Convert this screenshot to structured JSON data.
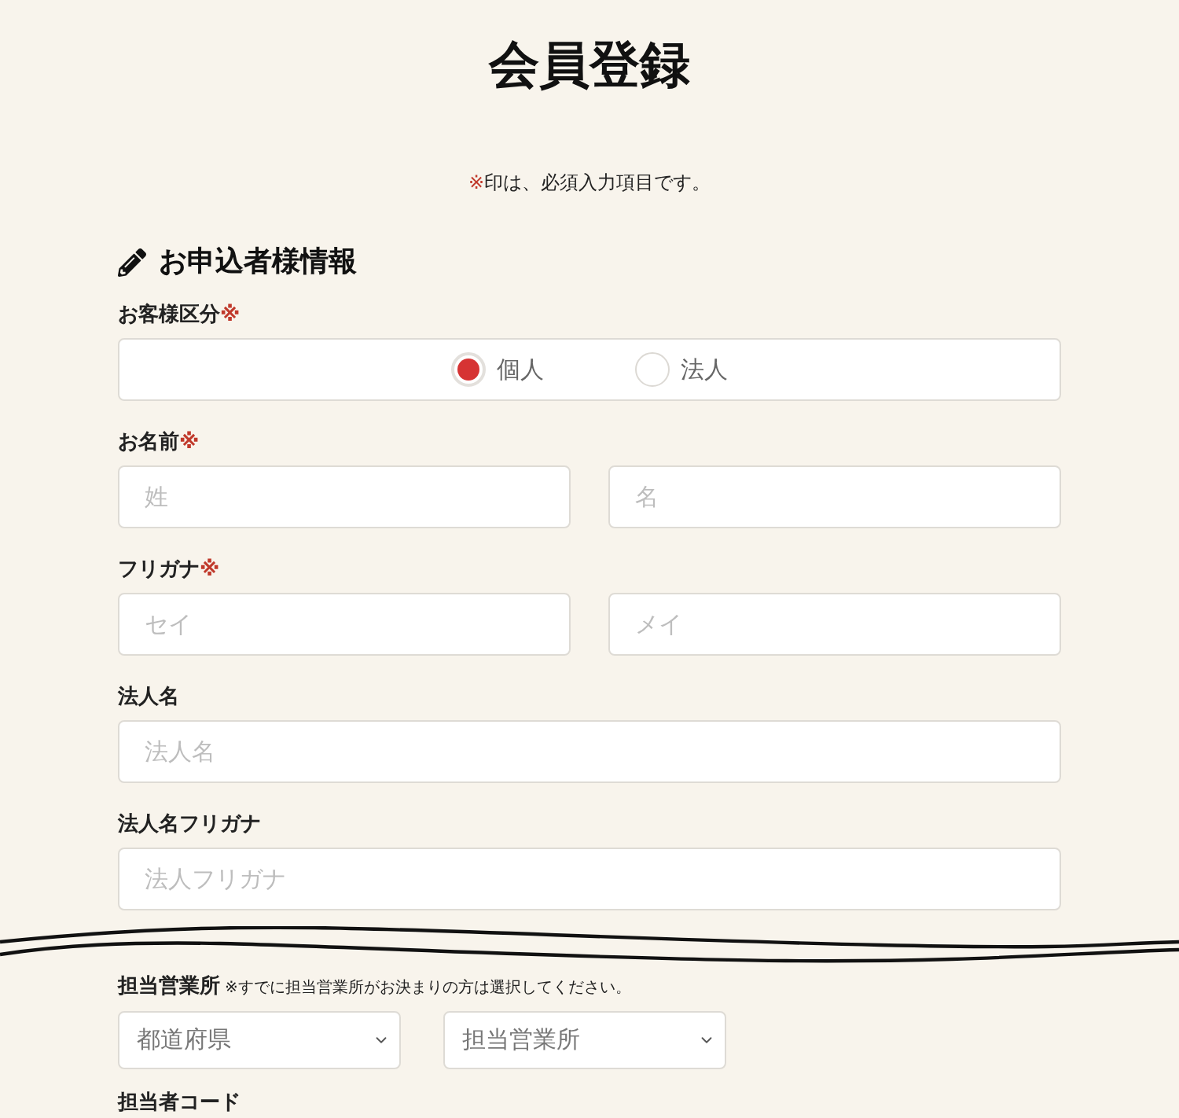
{
  "page": {
    "title": "会員登録",
    "required_note": {
      "mark": "※",
      "text": "印は、必須入力項目です。"
    }
  },
  "section": {
    "heading": "お申込者様情報"
  },
  "fields": [
    {
      "kind": "radio",
      "label": "お客様区分",
      "mark": "※",
      "options": [
        {
          "label": "個人",
          "selected": true
        },
        {
          "label": "法人",
          "selected": false
        }
      ]
    },
    {
      "kind": "text",
      "label": "お名前",
      "mark": "※",
      "inputs": [
        {
          "placeholder": "姓"
        },
        {
          "placeholder": "名"
        }
      ]
    },
    {
      "kind": "text",
      "label": "フリガナ",
      "mark": "※",
      "inputs": [
        {
          "placeholder": "セイ"
        },
        {
          "placeholder": "メイ"
        }
      ]
    },
    {
      "kind": "text",
      "label": "法人名",
      "inputs": [
        {
          "placeholder": "法人名"
        }
      ]
    },
    {
      "kind": "text",
      "label": "法人名フリガナ",
      "inputs": [
        {
          "placeholder": "法人フリガナ"
        }
      ]
    }
  ],
  "lower_fields": [
    {
      "kind": "select",
      "label": "担当営業所",
      "note": "※すでに担当営業所がお決まりの方は選択してください。",
      "selects": [
        {
          "value": "都道府県"
        },
        {
          "value": "担当営業所"
        }
      ]
    },
    {
      "kind": "label",
      "label": "担当者コード"
    }
  ]
}
